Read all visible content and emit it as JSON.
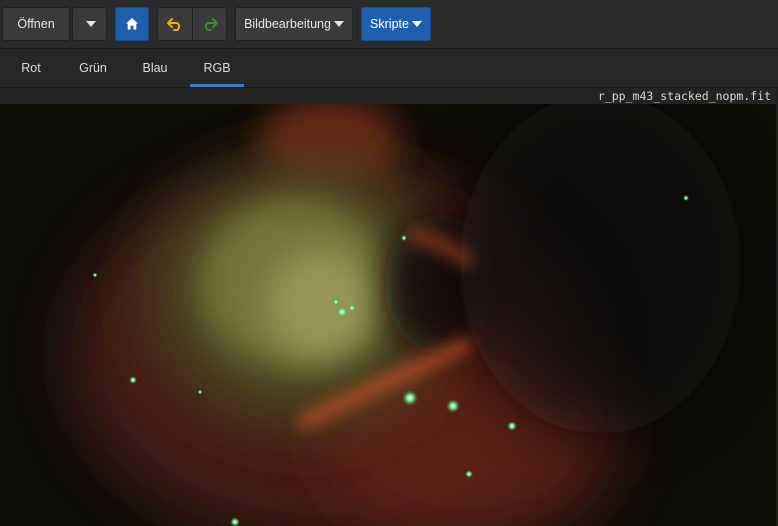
{
  "toolbar": {
    "open_label": "Öffnen",
    "edit_label": "Bildbearbeitung",
    "scripts_label": "Skripte",
    "accent_color": "#1f5fb0"
  },
  "tabs": {
    "items": [
      "Rot",
      "Grün",
      "Blau",
      "RGB"
    ],
    "active": "RGB"
  },
  "file": {
    "name": "r_pp_m43_stacked_nopm.fit"
  }
}
